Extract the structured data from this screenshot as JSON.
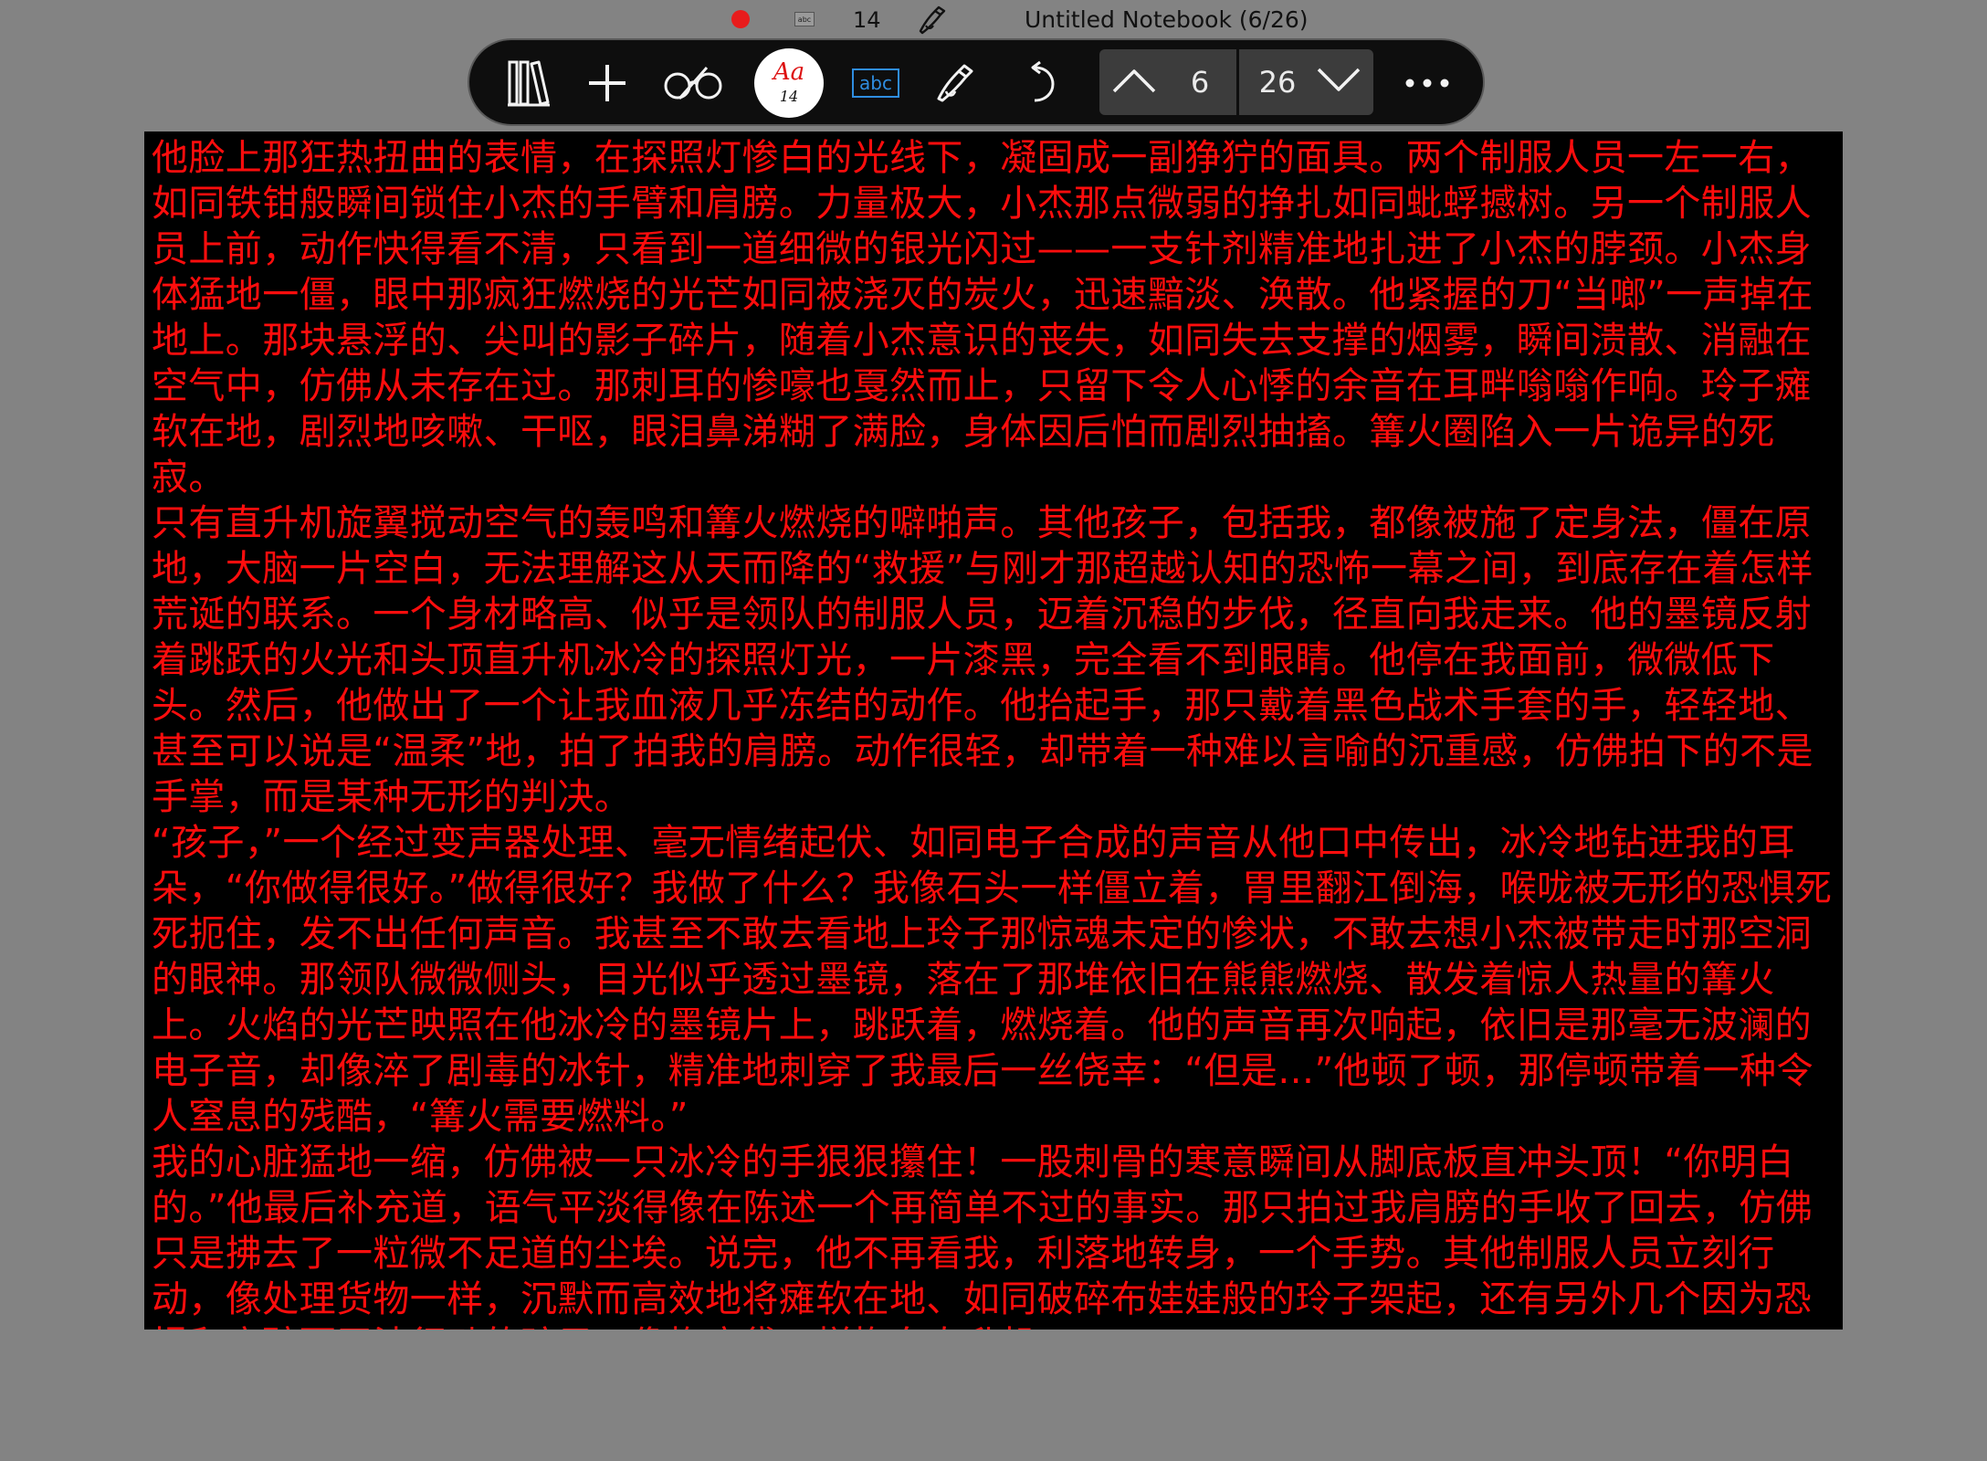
{
  "status_bar": {
    "record_icon": "record-dot-icon",
    "input_mode_icon": "abc",
    "font_size": "14",
    "pen_icon": "pen-icon",
    "title": "Untitled Notebook (6/26)",
    "record_color": "#e81c1c"
  },
  "toolbar": {
    "icons": {
      "library": "library-icon",
      "add": "plus-icon",
      "read_mode": "glasses-icon",
      "text_mode": "abc-icon",
      "pen": "pen-icon",
      "undo": "undo-icon",
      "more": "more-icon"
    },
    "font_button": {
      "label": "Aa",
      "size": "14"
    },
    "text_mode_label": "abc",
    "pager": {
      "current_page": "6",
      "total_pages": "26"
    },
    "accent_color": "#2f8de0"
  },
  "document": {
    "text_color": "#ff0d0d",
    "background": "#000000",
    "paragraphs": [
      "他脸上那狂热扭曲的表情，在探照灯惨白的光线下，凝固成一副狰狞的面具。两个制服人员一左一右，如同铁钳般瞬间锁住小杰的手臂和肩膀。力量极大，小杰那点微弱的挣扎如同蚍蜉撼树。另一个制服人员上前，动作快得看不清，只看到一道细微的银光闪过——一支针剂精准地扎进了小杰的脖颈。小杰身体猛地一僵，眼中那疯狂燃烧的光芒如同被浇灭的炭火，迅速黯淡、涣散。他紧握的刀“当啷”一声掉在地上。那块悬浮的、尖叫的影子碎片，随着小杰意识的丧失，如同失去支撑的烟雾，瞬间溃散、消融在空气中，仿佛从未存在过。那刺耳的惨嚎也戛然而止，只留下令人心悸的余音在耳畔嗡嗡作响。玲子瘫软在地，剧烈地咳嗽、干呕，眼泪鼻涕糊了满脸，身体因后怕而剧烈抽搐。篝火圈陷入一片诡异的死寂。",
      "只有直升机旋翼搅动空气的轰鸣和篝火燃烧的噼啪声。其他孩子，包括我，都像被施了定身法，僵在原地，大脑一片空白，无法理解这从天而降的“救援”与刚才那超越认知的恐怖一幕之间，到底存在着怎样荒诞的联系。一个身材略高、似乎是领队的制服人员，迈着沉稳的步伐，径直向我走来。他的墨镜反射着跳跃的火光和头顶直升机冰冷的探照灯光，一片漆黑，完全看不到眼睛。他停在我面前，微微低下头。然后，他做出了一个让我血液几乎冻结的动作。他抬起手，那只戴着黑色战术手套的手，轻轻地、甚至可以说是“温柔”地，拍了拍我的肩膀。动作很轻，却带着一种难以言喻的沉重感，仿佛拍下的不是手掌，而是某种无形的判决。",
      "“孩子，”一个经过变声器处理、毫无情绪起伏、如同电子合成的声音从他口中传出，冰冷地钻进我的耳朵，“你做得很好。”做得很好？我做了什么？我像石头一样僵立着，胃里翻江倒海，喉咙被无形的恐惧死死扼住，发不出任何声音。我甚至不敢去看地上玲子那惊魂未定的惨状，不敢去想小杰被带走时那空洞的眼神。那领队微微侧头，目光似乎透过墨镜，落在了那堆依旧在熊熊燃烧、散发着惊人热量的篝火上。火焰的光芒映照在他冰冷的墨镜片上，跳跃着，燃烧着。他的声音再次响起，依旧是那毫无波澜的电子音，却像淬了剧毒的冰针，精准地刺穿了我最后一丝侥幸：“但是…”他顿了顿，那停顿带着一种令人窒息的残酷，“篝火需要燃料。”",
      "我的心脏猛地一缩，仿佛被一只冰冷的手狠狠攥住！一股刺骨的寒意瞬间从脚底板直冲头顶！“你明白的。”他最后补充道，语气平淡得像在陈述一个再简单不过的事实。那只拍过我肩膀的手收了回去，仿佛只是拂去了一粒微不足道的尘埃。说完，他不再看我，利落地转身，一个手势。其他制服人员立刻行动，像处理货物一样，沉默而高效地将瘫软在地、如同破碎布娃娃般的玲子架起，还有另外几个因为恐惧和麻醉而无法行动的孩子，像拖麻袋一样拖向直升机。"
    ]
  }
}
